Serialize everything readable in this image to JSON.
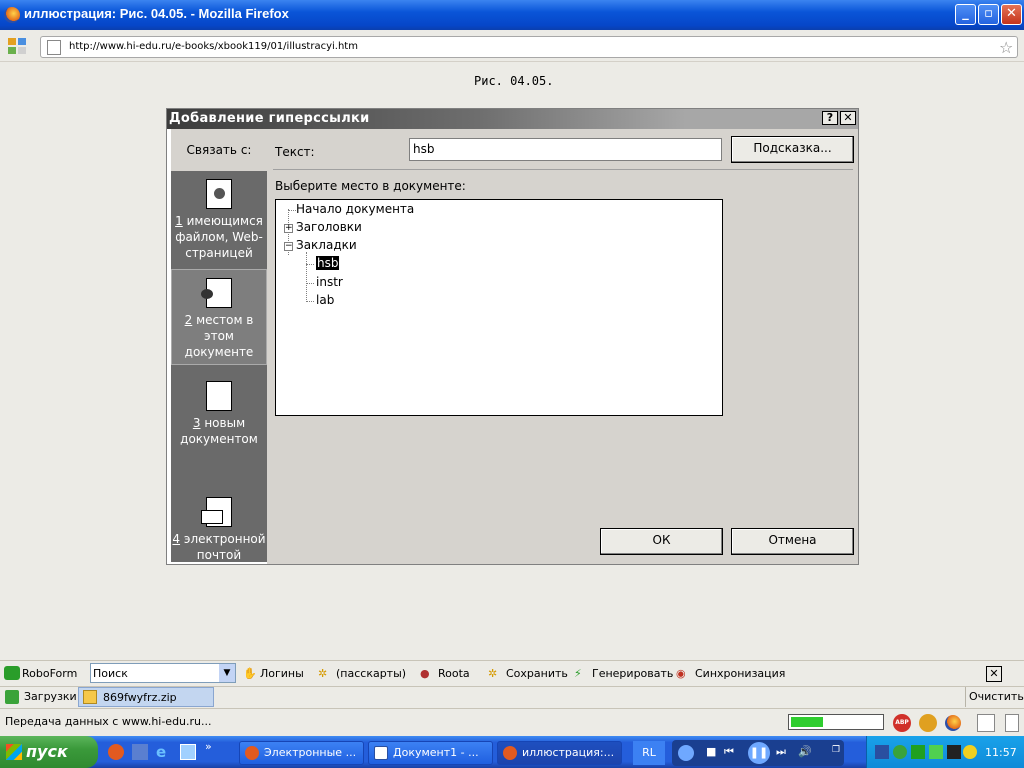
{
  "window": {
    "title": "иллюстрация: Рис. 04.05. - Mozilla Firefox"
  },
  "nav": {
    "url": "http://www.hi-edu.ru/e-books/xbook119/01/illustracyi.htm"
  },
  "page": {
    "caption": "Рис. 04.05."
  },
  "dialog": {
    "title": "Добавление гиперссылки",
    "help_btn": "?",
    "close_btn": "✕",
    "link_to_label": "Связать с:",
    "text_label": "Текст:",
    "text_value": "hsb",
    "hint_button": "Подсказка...",
    "choose_label": "Выберите место в документе:",
    "sidebar": [
      {
        "num": "1",
        "label": "имеющимся файлом, Web-страницей"
      },
      {
        "num": "2",
        "label": "местом в этом документе"
      },
      {
        "num": "3",
        "label": "новым документом"
      },
      {
        "num": "4",
        "label": "электронной почтой"
      }
    ],
    "tree": {
      "start": "Начало документа",
      "headings": "Заголовки",
      "bookmarks": "Закладки",
      "items": [
        "hsb",
        "instr",
        "lab"
      ]
    },
    "ok_button": "ОК",
    "cancel_button": "Отмена"
  },
  "roboform": {
    "name": "RoboForm",
    "search_placeholder": "Поиск",
    "logins": "Логины",
    "passcards": "(пасскарты)",
    "roota": "Roota",
    "save": "Сохранить",
    "generate": "Генерировать",
    "sync": "Синхронизация"
  },
  "downloads": {
    "label": "Загрузки",
    "file": "869fwyfrz.zip",
    "clear": "Очистить"
  },
  "status": {
    "text": "Передача данных с www.hi-edu.ru..."
  },
  "taskbar": {
    "start": "пуск",
    "tasks": [
      "Электронные ...",
      "Документ1 - ...",
      "иллюстрация:..."
    ],
    "lang": "RL",
    "clock": "11:57"
  }
}
